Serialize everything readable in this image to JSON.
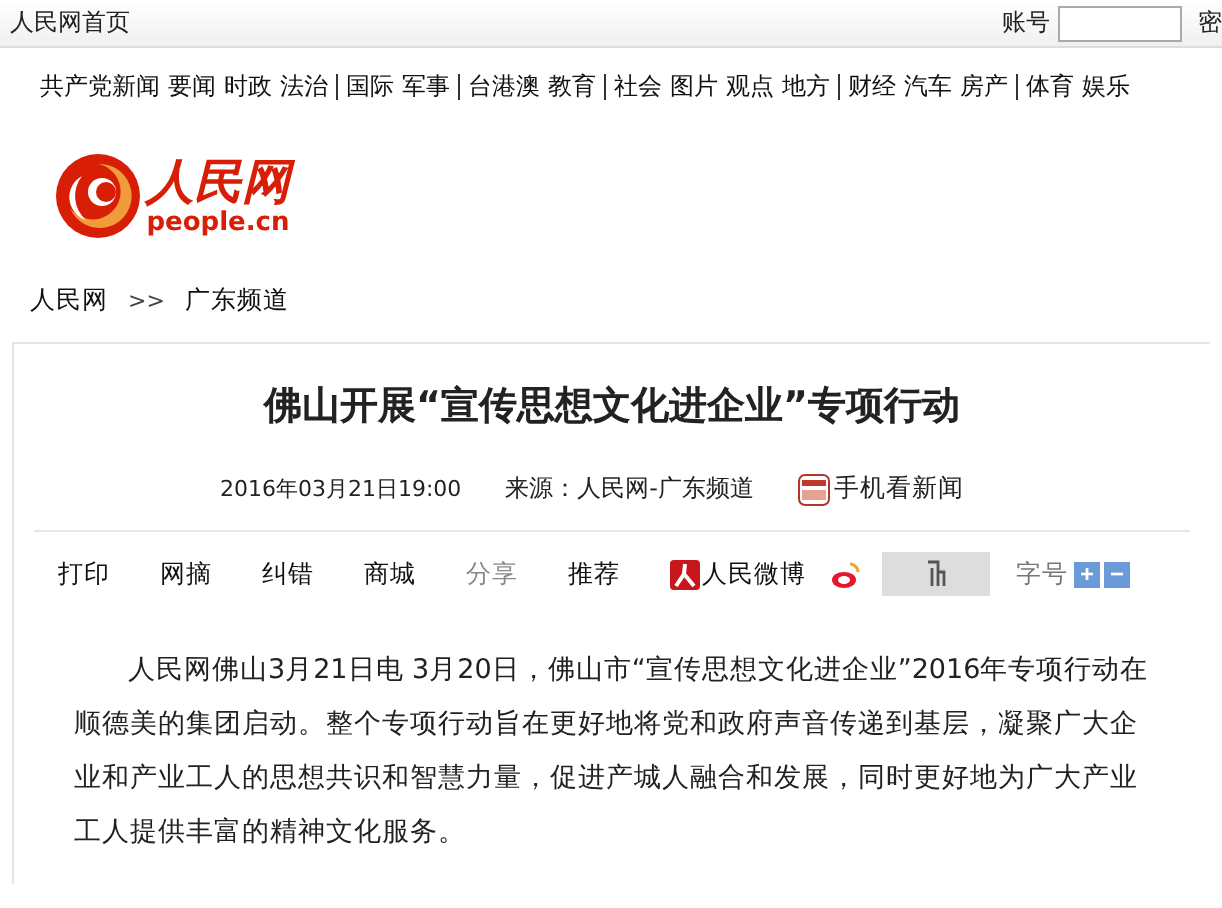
{
  "top_bar": {
    "home_link": "人民网首页",
    "account_label": "账号",
    "password_label": "密"
  },
  "nav": [
    {
      "label": "共产党新闻",
      "group_start": false
    },
    {
      "label": "要闻",
      "group_start": false
    },
    {
      "label": "时政",
      "group_start": false
    },
    {
      "label": "法治",
      "group_start": false
    },
    {
      "label": "国际",
      "group_start": true
    },
    {
      "label": "军事",
      "group_start": false
    },
    {
      "label": "台港澳",
      "group_start": true
    },
    {
      "label": "教育",
      "group_start": false
    },
    {
      "label": "社会",
      "group_start": true
    },
    {
      "label": "图片",
      "group_start": false
    },
    {
      "label": "观点",
      "group_start": false
    },
    {
      "label": "地方",
      "group_start": false
    },
    {
      "label": "财经",
      "group_start": true
    },
    {
      "label": "汽车",
      "group_start": false
    },
    {
      "label": "房产",
      "group_start": false
    },
    {
      "label": "体育",
      "group_start": true
    },
    {
      "label": "娱乐",
      "group_start": false
    }
  ],
  "logo": {
    "name": "人民网",
    "domain": "people.cn"
  },
  "breadcrumb": [
    "人民网",
    "广东频道"
  ],
  "breadcrumb_separator": ">>",
  "article": {
    "title": "佛山开展“宣传思想文化进企业”专项行动",
    "date": "2016年03月21日19:00",
    "source": "来源：人民网-广东频道",
    "mobile_link": "手机看新闻",
    "toolbar": [
      {
        "kind": "link",
        "label": "打印"
      },
      {
        "kind": "link",
        "label": "网摘"
      },
      {
        "kind": "link",
        "label": "纠错"
      },
      {
        "kind": "link",
        "label": "商城"
      },
      {
        "kind": "label",
        "label": "分享"
      },
      {
        "kind": "link",
        "label": "推荐"
      },
      {
        "kind": "weibo",
        "label": "人民微博"
      },
      {
        "kind": "sina"
      },
      {
        "kind": "grey_box"
      }
    ],
    "font_size": {
      "label": "字号",
      "increase": "+",
      "decrease": "−"
    },
    "body": "人民网佛山3月21日电 3月20日，佛山市“宣传思想文化进企业”2016年专项行动在顺德美的集团启动。整个专项行动旨在更好地将党和政府声音传递到基层，凝聚广大企业和产业工人的思想共识和智慧力量，促进产城人融合和发展，同时更好地为广大产业工人提供丰富的精神文化服务。"
  }
}
